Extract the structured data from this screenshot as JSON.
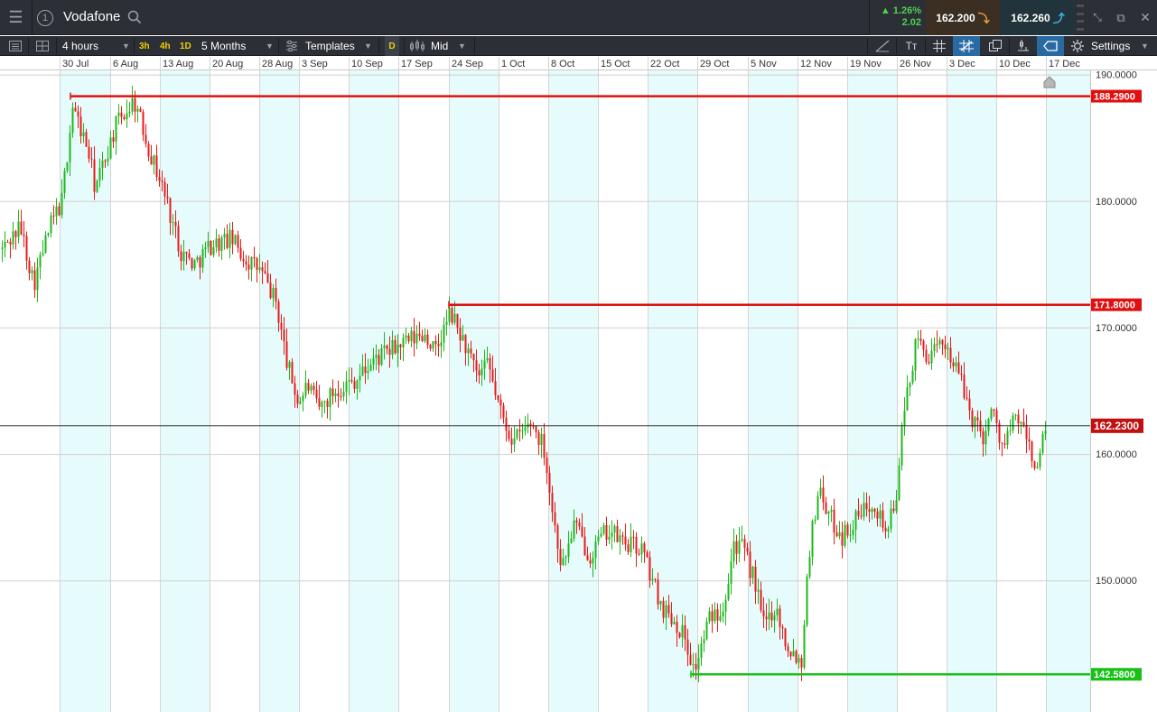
{
  "header": {
    "instrument": "Vodafone",
    "change_pct": "▲ 1.26%",
    "change_abs": "2.02",
    "sell_price": "162.200",
    "buy_price": "162.260",
    "info_number": "1"
  },
  "toolbar": {
    "interval": "4 hours",
    "quick_3h": "3h",
    "quick_4h": "4h",
    "quick_1d": "1D",
    "period": "5 Months",
    "templates": "Templates",
    "d_label": "D",
    "price_type": "Mid",
    "text_tool": "Tт",
    "settings": "Settings"
  },
  "colors": {
    "up": "#1cb81c",
    "down": "#e81b1b",
    "band": "#e6fbfb",
    "resistance": "#e01010",
    "support": "#18c018",
    "current_price_label": "#c0100f"
  },
  "chart_data": {
    "type": "candlestick",
    "title": "Vodafone",
    "x_tick_labels": [
      "30 Jul",
      "6 Aug",
      "13 Aug",
      "20 Aug",
      "28 Aug",
      "3 Sep",
      "10 Sep",
      "17 Sep",
      "24 Sep",
      "1 Oct",
      "8 Oct",
      "15 Oct",
      "22 Oct",
      "29 Oct",
      "5 Nov",
      "12 Nov",
      "19 Nov",
      "26 Nov",
      "3 Dec",
      "10 Dec",
      "17 Dec"
    ],
    "y_ticks": [
      150,
      160,
      170,
      180,
      190
    ],
    "y_tick_labels": [
      "150.0000",
      "160.0000",
      "170.0000",
      "180.0000",
      "190.0000"
    ],
    "ylim": [
      139.6,
      190.4
    ],
    "current_price": 162.23,
    "current_price_label": "162.2300",
    "horizontal_levels": [
      {
        "value": 188.29,
        "label": "188.2900",
        "color": "#e01010",
        "from": "30 Jul"
      },
      {
        "value": 171.8,
        "label": "171.8000",
        "color": "#e01010",
        "from": "24 Sep"
      },
      {
        "value": 142.58,
        "label": "142.5800",
        "color": "#18c018",
        "from": "26 Oct"
      }
    ],
    "waypoints": [
      {
        "x": 0,
        "p": 176
      },
      {
        "x": 22,
        "p": 178
      },
      {
        "x": 37,
        "p": 173.5
      },
      {
        "x": 55,
        "p": 178
      },
      {
        "x": 68,
        "p": 180
      },
      {
        "x": 80,
        "p": 187.5
      },
      {
        "x": 97,
        "p": 184
      },
      {
        "x": 105,
        "p": 181
      },
      {
        "x": 128,
        "p": 186
      },
      {
        "x": 148,
        "p": 188
      },
      {
        "x": 165,
        "p": 184
      },
      {
        "x": 180,
        "p": 181
      },
      {
        "x": 200,
        "p": 176
      },
      {
        "x": 215,
        "p": 175
      },
      {
        "x": 232,
        "p": 176.5
      },
      {
        "x": 256,
        "p": 177
      },
      {
        "x": 270,
        "p": 175.5
      },
      {
        "x": 288,
        "p": 174.5
      },
      {
        "x": 305,
        "p": 172
      },
      {
        "x": 318,
        "p": 167
      },
      {
        "x": 330,
        "p": 164
      },
      {
        "x": 340,
        "p": 165.5
      },
      {
        "x": 352,
        "p": 163.5
      },
      {
        "x": 370,
        "p": 165
      },
      {
        "x": 395,
        "p": 166
      },
      {
        "x": 415,
        "p": 167.5
      },
      {
        "x": 440,
        "p": 168.5
      },
      {
        "x": 470,
        "p": 169.5
      },
      {
        "x": 482,
        "p": 168
      },
      {
        "x": 498,
        "p": 171.2
      },
      {
        "x": 515,
        "p": 168.5
      },
      {
        "x": 528,
        "p": 166
      },
      {
        "x": 540,
        "p": 167
      },
      {
        "x": 555,
        "p": 163
      },
      {
        "x": 568,
        "p": 161
      },
      {
        "x": 588,
        "p": 162.5
      },
      {
        "x": 602,
        "p": 160.5
      },
      {
        "x": 612,
        "p": 155
      },
      {
        "x": 622,
        "p": 151
      },
      {
        "x": 635,
        "p": 154.5
      },
      {
        "x": 652,
        "p": 152
      },
      {
        "x": 672,
        "p": 154
      },
      {
        "x": 690,
        "p": 153
      },
      {
        "x": 710,
        "p": 152.5
      },
      {
        "x": 722,
        "p": 150
      },
      {
        "x": 732,
        "p": 148
      },
      {
        "x": 745,
        "p": 147
      },
      {
        "x": 758,
        "p": 145.5
      },
      {
        "x": 768,
        "p": 142.8
      },
      {
        "x": 785,
        "p": 147
      },
      {
        "x": 800,
        "p": 148
      },
      {
        "x": 812,
        "p": 153
      },
      {
        "x": 822,
        "p": 152.5
      },
      {
        "x": 835,
        "p": 150
      },
      {
        "x": 845,
        "p": 146.5
      },
      {
        "x": 858,
        "p": 148
      },
      {
        "x": 870,
        "p": 145
      },
      {
        "x": 888,
        "p": 143.5
      },
      {
        "x": 893,
        "p": 151
      },
      {
        "x": 906,
        "p": 157.5
      },
      {
        "x": 918,
        "p": 155
      },
      {
        "x": 932,
        "p": 153.5
      },
      {
        "x": 950,
        "p": 155
      },
      {
        "x": 966,
        "p": 156.5
      },
      {
        "x": 980,
        "p": 154
      },
      {
        "x": 990,
        "p": 155.5
      },
      {
        "x": 997,
        "p": 161
      },
      {
        "x": 1005,
        "p": 165.5
      },
      {
        "x": 1015,
        "p": 169
      },
      {
        "x": 1030,
        "p": 167.5
      },
      {
        "x": 1045,
        "p": 169
      },
      {
        "x": 1060,
        "p": 166.5
      },
      {
        "x": 1075,
        "p": 163
      },
      {
        "x": 1088,
        "p": 161.5
      },
      {
        "x": 1098,
        "p": 163.5
      },
      {
        "x": 1110,
        "p": 160.5
      },
      {
        "x": 1125,
        "p": 163
      },
      {
        "x": 1138,
        "p": 161
      },
      {
        "x": 1147,
        "p": 158.5
      },
      {
        "x": 1158,
        "p": 162.2
      }
    ]
  }
}
